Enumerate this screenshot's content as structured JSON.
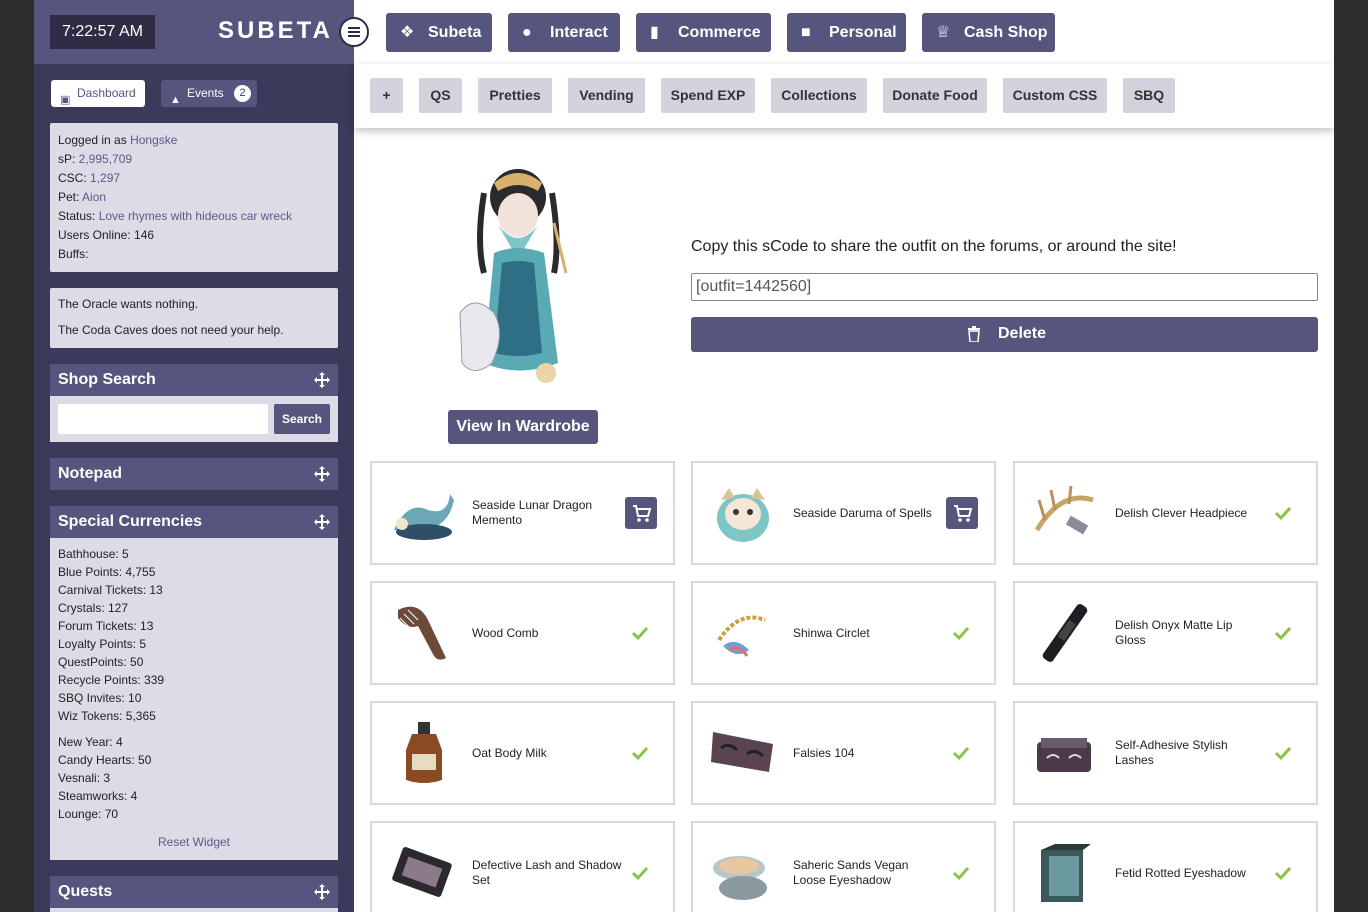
{
  "clock": "7:22:57 AM",
  "logo": "SUBETA",
  "nav": [
    "Subeta",
    "Interact",
    "Commerce",
    "Personal",
    "Cash Shop"
  ],
  "subnav": [
    "+",
    "QS",
    "Pretties",
    "Vending",
    "Spend EXP",
    "Collections",
    "Donate Food",
    "Custom CSS",
    "SBQ"
  ],
  "sidebar": {
    "tabs": {
      "dashboard": "Dashboard",
      "events": "Events",
      "events_count": "2"
    },
    "info": {
      "logged_label": "Logged in as ",
      "user": "Hongske",
      "sp_label": "sP: ",
      "sp": "2,995,709",
      "csc_label": "CSC: ",
      "csc": "1,297",
      "pet_label": "Pet: ",
      "pet": "Aion",
      "status_label": "Status: ",
      "status": "Love rhymes with hideous car wreck",
      "online": "Users Online: 146",
      "buffs": "Buffs:"
    },
    "oracle": [
      "The Oracle wants nothing.",
      "The Coda Caves does not need your help."
    ],
    "shop_search": {
      "title": "Shop Search",
      "button": "Search"
    },
    "notepad": "Notepad",
    "currencies": {
      "title": "Special Currencies",
      "items": [
        "Bathhouse: 5",
        "Blue Points: 4,755",
        "Carnival Tickets: 13",
        "Crystals: 127",
        "Forum Tickets: 13",
        "Loyalty Points: 5",
        "QuestPoints: 50",
        "Recycle Points: 339",
        "SBQ Invites: 10",
        "Wiz Tokens: 5,365"
      ],
      "seasonal": [
        "New Year: 4",
        "Candy Hearts: 50",
        "Vesnali: 3",
        "Steamworks: 4",
        "Lounge: 70"
      ],
      "reset": "Reset Widget"
    },
    "quests": "Quests"
  },
  "main": {
    "wardrobe_button": "View In Wardrobe",
    "copy_text": "Copy this sCode to share the outfit on the forums, or around the site!",
    "scode": "[outfit=1442560]",
    "delete_button": "Delete",
    "items": [
      {
        "name": "Seaside Lunar Dragon Memento",
        "owned": false
      },
      {
        "name": "Seaside Daruma of Spells",
        "owned": false
      },
      {
        "name": "Delish Clever Headpiece",
        "owned": true
      },
      {
        "name": "Wood Comb",
        "owned": true
      },
      {
        "name": "Shinwa Circlet",
        "owned": true
      },
      {
        "name": "Delish Onyx Matte Lip Gloss",
        "owned": true
      },
      {
        "name": "Oat Body Milk",
        "owned": true
      },
      {
        "name": "Falsies 104",
        "owned": true
      },
      {
        "name": "Self-Adhesive Stylish Lashes",
        "owned": true
      },
      {
        "name": "Defective Lash and Shadow Set",
        "owned": true
      },
      {
        "name": "Saheric Sands Vegan Loose Eyeshadow",
        "owned": true
      },
      {
        "name": "Fetid Rotted Eyeshadow",
        "owned": true
      }
    ]
  },
  "colors": {
    "accent": "#56557e",
    "sidebar": "#3b3a5b",
    "panel": "#dcdbe6",
    "check": "#8ac24a"
  }
}
